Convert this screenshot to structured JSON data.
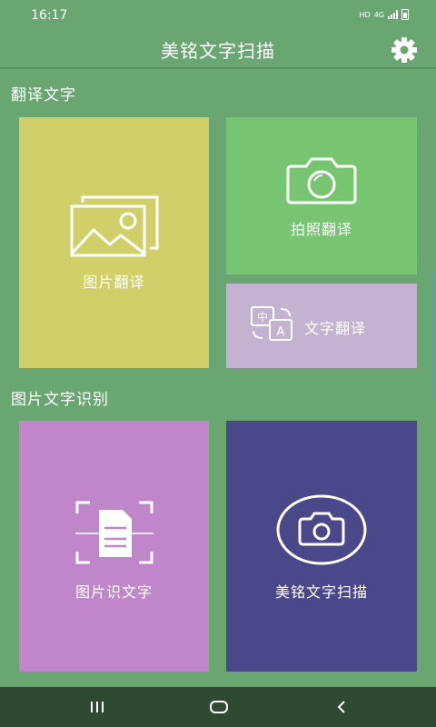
{
  "status": {
    "time": "16:17",
    "hd": "HD",
    "net": "4G"
  },
  "app": {
    "title": "美铭文字扫描"
  },
  "sections": {
    "translate": "翻译文字",
    "ocr": "图片文字识别"
  },
  "tiles": {
    "image_translate": {
      "label": "图片翻译",
      "color": "#d1cf6a"
    },
    "photo_translate": {
      "label": "拍照翻译",
      "color": "#77c571"
    },
    "text_translate": {
      "label": "文字翻译",
      "color": "#c4b2d1",
      "glyph_zh": "中",
      "glyph_en": "A"
    },
    "image_ocr": {
      "label": "图片识文字",
      "color": "#bf86ca"
    },
    "scan": {
      "label": "美铭文字扫描",
      "color": "#4b4889"
    }
  },
  "icons": [
    "settings-gear-icon",
    "pictures-icon",
    "camera-icon",
    "translate-icon",
    "document-scan-icon",
    "camera-circle-icon"
  ],
  "colors": {
    "background": "#6aa672",
    "nav": "#2e4a33"
  }
}
